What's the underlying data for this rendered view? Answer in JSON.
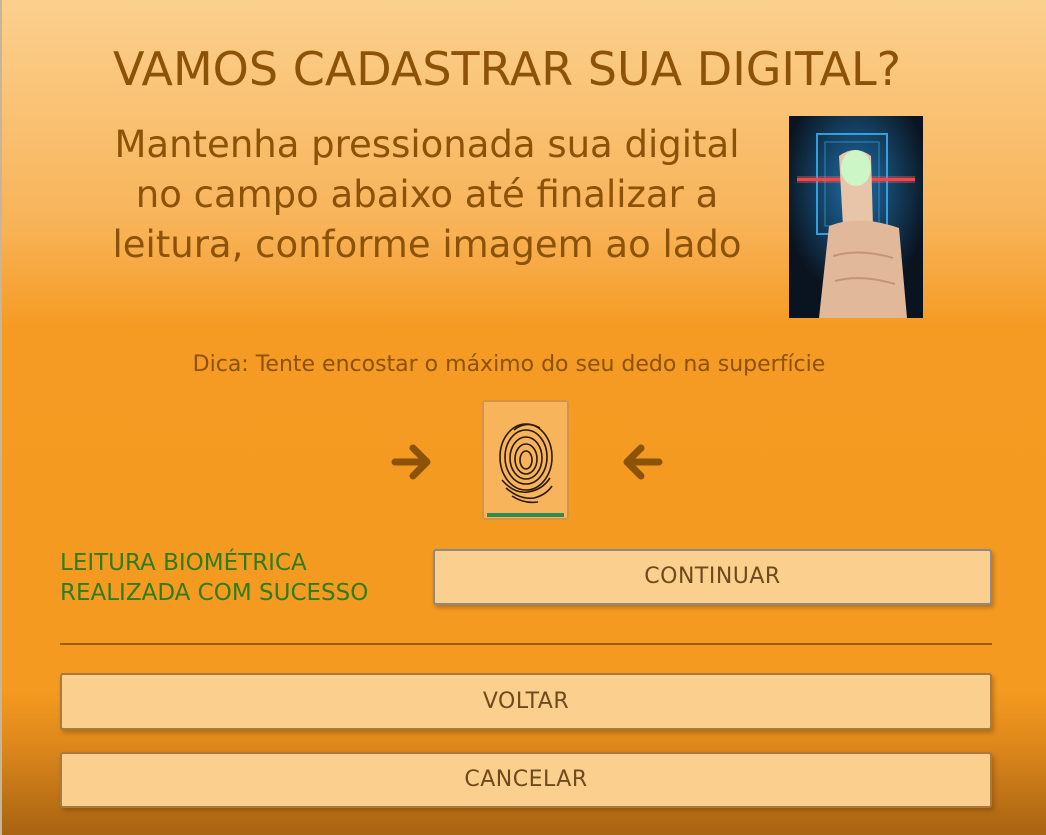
{
  "page": {
    "title": "VAMOS CADASTRAR SUA DIGITAL?",
    "instruction": "Mantenha pressionada sua digital no campo abaixo até finalizar a leitura, conforme imagem ao lado",
    "tip": "Dica: Tente encostar o máximo do seu dedo na superfície"
  },
  "scanner": {
    "arrow_right_icon": "arrow-right-icon",
    "arrow_left_icon": "arrow-left-icon",
    "fingerprint_icon": "fingerprint-icon"
  },
  "status": {
    "message": "LEITURA BIOMÉTRICA REALIZADA COM SUCESSO",
    "color": "#2e7d1a"
  },
  "buttons": {
    "continuar": "CONTINUAR",
    "voltar": "VOLTAR",
    "cancelar": "CANCELAR"
  },
  "colors": {
    "text_brown": "#8c5207",
    "button_bg": "#fbd08e",
    "background_orange": "#f59a22",
    "progress_green": "#2e8b57"
  }
}
